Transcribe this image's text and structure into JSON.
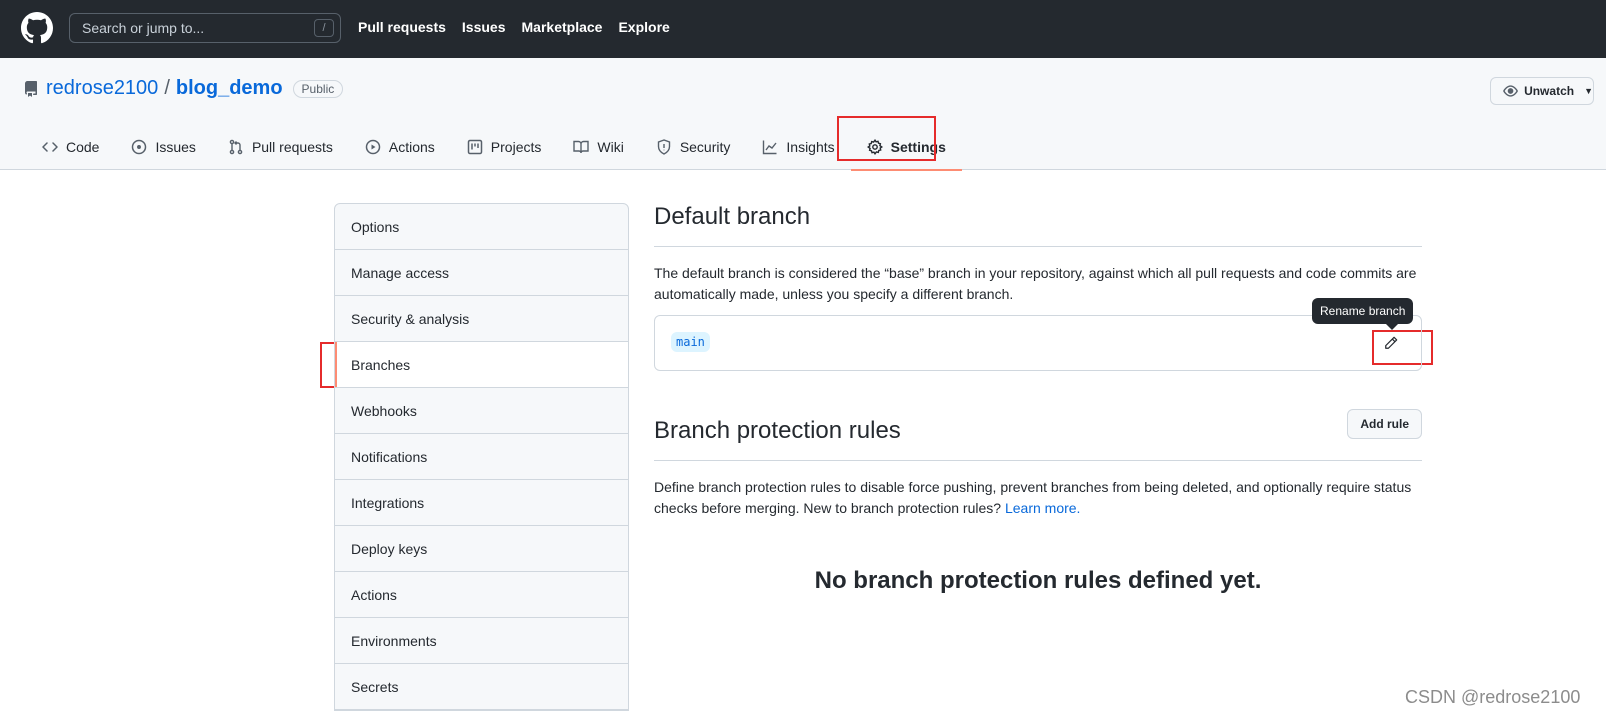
{
  "header": {
    "search_placeholder": "Search or jump to...",
    "search_shortcut": "/",
    "nav": [
      "Pull requests",
      "Issues",
      "Marketplace",
      "Explore"
    ]
  },
  "repo": {
    "owner": "redrose2100",
    "separator": "/",
    "name": "blog_demo",
    "visibility": "Public",
    "unwatch_label": "Unwatch"
  },
  "tabs": [
    {
      "label": "Code",
      "icon": "code-icon"
    },
    {
      "label": "Issues",
      "icon": "issue-icon"
    },
    {
      "label": "Pull requests",
      "icon": "pull-request-icon"
    },
    {
      "label": "Actions",
      "icon": "play-icon"
    },
    {
      "label": "Projects",
      "icon": "project-icon"
    },
    {
      "label": "Wiki",
      "icon": "book-icon"
    },
    {
      "label": "Security",
      "icon": "shield-icon"
    },
    {
      "label": "Insights",
      "icon": "graph-icon"
    },
    {
      "label": "Settings",
      "icon": "gear-icon",
      "active": true
    }
  ],
  "sidebar": {
    "items": [
      {
        "label": "Options"
      },
      {
        "label": "Manage access"
      },
      {
        "label": "Security & analysis"
      },
      {
        "label": "Branches",
        "selected": true
      },
      {
        "label": "Webhooks"
      },
      {
        "label": "Notifications"
      },
      {
        "label": "Integrations"
      },
      {
        "label": "Deploy keys"
      },
      {
        "label": "Actions"
      },
      {
        "label": "Environments"
      },
      {
        "label": "Secrets"
      }
    ]
  },
  "default_branch": {
    "title": "Default branch",
    "description": "The default branch is considered the “base” branch in your repository, against which all pull requests and code commits are automatically made, unless you specify a different branch.",
    "branch": "main",
    "tooltip": "Rename branch"
  },
  "protection": {
    "title": "Branch protection rules",
    "add_rule_label": "Add rule",
    "description": "Define branch protection rules to disable force pushing, prevent branches from being deleted, and optionally require status checks before merging. New to branch protection rules?",
    "learn_more": "Learn more.",
    "empty_message": "No branch protection rules defined yet."
  },
  "watermark": "CSDN @redrose2100",
  "colors": {
    "header_bg": "#24292f",
    "link": "#0969da",
    "highlight_box": "#e52b2b",
    "active_underline": "#fd8c73"
  }
}
